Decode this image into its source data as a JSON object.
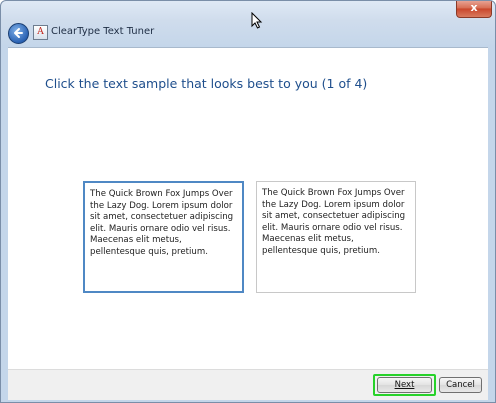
{
  "window": {
    "title": "ClearType Text Tuner",
    "close_label": "x"
  },
  "content": {
    "heading": "Click the text sample that looks best to you (1 of 4)",
    "samples": [
      {
        "text": "The Quick Brown Fox Jumps Over the Lazy Dog. Lorem ipsum dolor sit amet, consectetuer adipiscing elit. Mauris ornare odio vel risus. Maecenas elit metus, pellentesque quis, pretium."
      },
      {
        "text": "The Quick Brown Fox Jumps Over the Lazy Dog. Lorem ipsum dolor sit amet, consectetuer adipiscing elit. Mauris ornare odio vel risus. Maecenas elit metus, pellentesque quis, pretium."
      }
    ]
  },
  "footer": {
    "next_label": "Next",
    "cancel_label": "Cancel"
  },
  "colors": {
    "heading": "#1e4e8c",
    "selected_border": "#4f88c4",
    "highlight_ring": "#27d22a"
  }
}
